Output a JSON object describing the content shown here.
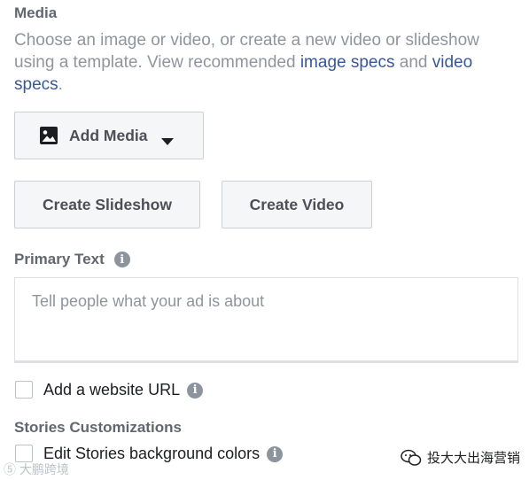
{
  "media": {
    "title": "Media",
    "desc_part1": "Choose an image or video, or create a new video or slideshow using a template. View recommended ",
    "image_specs_link": "image specs",
    "desc_and": " and ",
    "video_specs_link": "video specs",
    "desc_period": ".",
    "add_media_label": "Add Media",
    "add_media_icon": "image-icon",
    "dropdown_icon": "caret-down-icon",
    "create_slideshow_label": "Create Slideshow",
    "create_video_label": "Create Video"
  },
  "primary_text": {
    "label": "Primary Text",
    "info_icon": "i",
    "placeholder": "Tell people what your ad is about"
  },
  "website_url": {
    "label": "Add a website URL",
    "info_icon": "i"
  },
  "stories": {
    "title": "Stories Customizations",
    "bg_colors_label": "Edit Stories background colors",
    "info_icon": "i"
  },
  "watermarks": {
    "left": "⑤ 大鹏跨境",
    "right": "投大大出海营销"
  },
  "colors": {
    "link": "#365899",
    "muted_text": "#90949c",
    "heading": "#606770",
    "button_bg": "#f5f6f7",
    "border": "#ccd0d5"
  }
}
